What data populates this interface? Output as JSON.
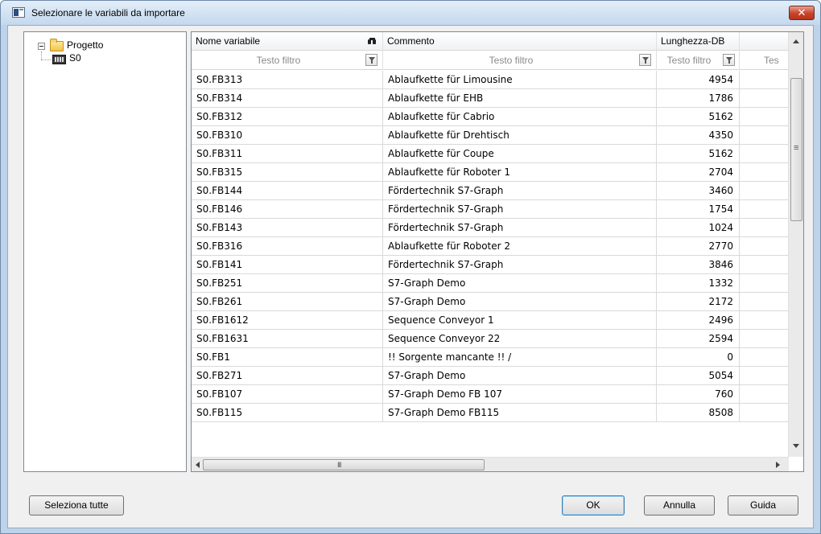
{
  "window": {
    "title": "Selezionare le variabili da importare",
    "close_glyph": "✕"
  },
  "tree": {
    "root_label": "Progetto",
    "child_label": "S0"
  },
  "grid": {
    "columns": [
      {
        "label": "Nome variabile",
        "filter_placeholder": "Testo filtro"
      },
      {
        "label": "Commento",
        "filter_placeholder": "Testo filtro"
      },
      {
        "label": "Lunghezza-DB",
        "filter_placeholder": "Testo filtro"
      },
      {
        "label": "",
        "filter_placeholder": "Tes"
      }
    ],
    "rows": [
      {
        "name": "S0.FB313",
        "comment": "Ablaufkette für Limousine",
        "length": "4954"
      },
      {
        "name": "S0.FB314",
        "comment": "Ablaufkette für EHB",
        "length": "1786"
      },
      {
        "name": "S0.FB312",
        "comment": "Ablaufkette für Cabrio",
        "length": "5162"
      },
      {
        "name": "S0.FB310",
        "comment": "Ablaufkette für Drehtisch",
        "length": "4350"
      },
      {
        "name": "S0.FB311",
        "comment": "Ablaufkette für Coupe",
        "length": "5162"
      },
      {
        "name": "S0.FB315",
        "comment": "Ablaufkette für Roboter 1",
        "length": "2704"
      },
      {
        "name": "S0.FB144",
        "comment": "Fördertechnik S7-Graph",
        "length": "3460"
      },
      {
        "name": "S0.FB146",
        "comment": "Fördertechnik S7-Graph",
        "length": "1754"
      },
      {
        "name": "S0.FB143",
        "comment": "Fördertechnik S7-Graph",
        "length": "1024"
      },
      {
        "name": "S0.FB316",
        "comment": "Ablaufkette für Roboter 2",
        "length": "2770"
      },
      {
        "name": "S0.FB141",
        "comment": "Fördertechnik S7-Graph",
        "length": "3846"
      },
      {
        "name": "S0.FB251",
        "comment": "S7-Graph Demo",
        "length": "1332"
      },
      {
        "name": "S0.FB261",
        "comment": "S7-Graph Demo",
        "length": "2172"
      },
      {
        "name": "S0.FB1612",
        "comment": "Sequence Conveyor 1",
        "length": "2496"
      },
      {
        "name": "S0.FB1631",
        "comment": "Sequence Conveyor 22",
        "length": "2594"
      },
      {
        "name": "S0.FB1",
        "comment": "!! Sorgente mancante !! /",
        "length": "0"
      },
      {
        "name": "S0.FB271",
        "comment": "S7-Graph Demo",
        "length": "5054"
      },
      {
        "name": "S0.FB107",
        "comment": "S7-Graph Demo FB 107",
        "length": "760"
      },
      {
        "name": "S0.FB115",
        "comment": "S7-Graph Demo FB115",
        "length": "8508"
      }
    ],
    "hscroll_grip": "III",
    "vscroll_grip": "≡"
  },
  "buttons": {
    "select_all": "Seleziona tutte",
    "ok": "OK",
    "cancel": "Annulla",
    "help": "Guida"
  },
  "colors": {
    "titlebar": "#c4d8ee",
    "close_button": "#c7432b",
    "default_button_border": "#3c7fb1"
  }
}
